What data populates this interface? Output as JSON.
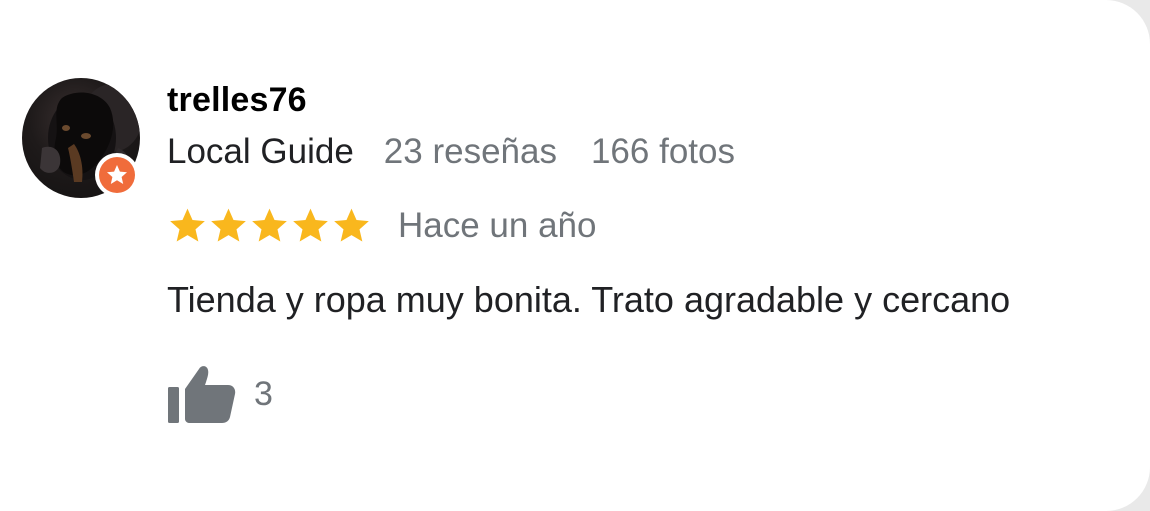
{
  "review": {
    "author": {
      "name": "trelles76",
      "badge": "Local Guide",
      "reviews": "23 reseñas",
      "photos": "166 fotos",
      "avatar_icon": "dog-avatar",
      "badge_icon": "local-guide-star-icon"
    },
    "rating": {
      "stars": 5,
      "max_stars": 5,
      "star_color": "#f9b71d"
    },
    "time": "Hace un año",
    "text": "Tienda y ropa muy bonita. Trato agradable y cercano",
    "likes": {
      "icon": "thumbs-up-icon",
      "count": "3"
    }
  },
  "colors": {
    "badge": "#f06c3b",
    "secondary_text": "#70757a",
    "primary_text": "#202124"
  }
}
